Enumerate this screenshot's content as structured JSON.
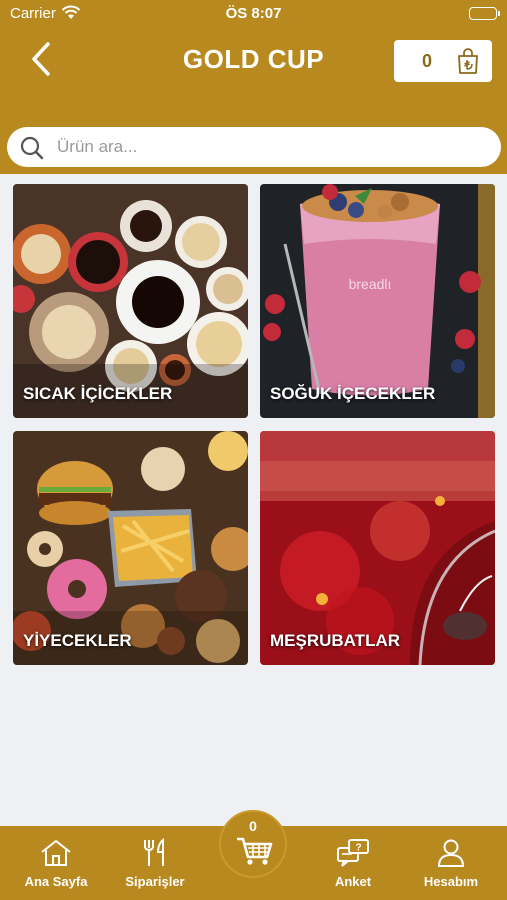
{
  "status_bar": {
    "carrier": "Carrier",
    "time": "ÖS 8:07"
  },
  "header": {
    "title": "GOLD CUP",
    "cart_count": "0"
  },
  "search": {
    "placeholder": "Ürün ara..."
  },
  "categories": [
    {
      "label": "SICAK İÇİCEKLER"
    },
    {
      "label": "SOĞUK İÇECEKLER"
    },
    {
      "label": "YİYECEKLER"
    },
    {
      "label": "MEŞRUBATLAR"
    }
  ],
  "tabbar": {
    "home": "Ana Sayfa",
    "orders": "Siparişler",
    "cart_count": "0",
    "survey": "Anket",
    "account": "Hesabım"
  },
  "colors": {
    "brand": "#b8891f",
    "background": "#eef0f4"
  }
}
